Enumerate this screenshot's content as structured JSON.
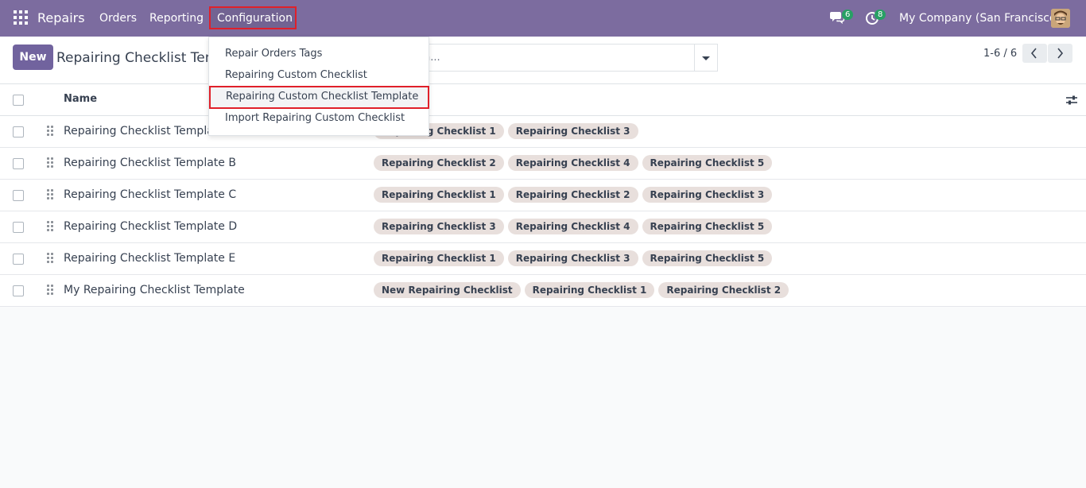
{
  "navbar": {
    "brand": "Repairs",
    "menu": [
      "Orders",
      "Reporting",
      "Configuration"
    ],
    "messages_count": "6",
    "activities_count": "8",
    "company": "My Company (San Francisco)"
  },
  "control_panel": {
    "new_label": "New",
    "breadcrumb": "Repairing Checklist Templ",
    "search_placeholder": "h...",
    "pager": "1-6 / 6"
  },
  "table": {
    "header_name": "Name",
    "rows": [
      {
        "name": "Repairing Checklist Template",
        "tags": [
          "Repairing Checklist 1",
          "Repairing Checklist 3"
        ]
      },
      {
        "name": "Repairing Checklist Template B",
        "tags": [
          "Repairing Checklist 2",
          "Repairing Checklist 4",
          "Repairing Checklist 5"
        ]
      },
      {
        "name": "Repairing Checklist Template C",
        "tags": [
          "Repairing Checklist 1",
          "Repairing Checklist 2",
          "Repairing Checklist 3"
        ]
      },
      {
        "name": "Repairing Checklist Template D",
        "tags": [
          "Repairing Checklist 3",
          "Repairing Checklist 4",
          "Repairing Checklist 5"
        ]
      },
      {
        "name": "Repairing Checklist Template E",
        "tags": [
          "Repairing Checklist 1",
          "Repairing Checklist 3",
          "Repairing Checklist 5"
        ]
      },
      {
        "name": "My Repairing Checklist Template",
        "tags": [
          "New Repairing Checklist",
          "Repairing Checklist 1",
          "Repairing Checklist 2"
        ]
      }
    ]
  },
  "config_menu": {
    "items": [
      "Repair Orders Tags",
      "Repairing Custom Checklist",
      "Repairing Custom Checklist Template",
      "Import Repairing Custom Checklist"
    ]
  },
  "colors": {
    "navbar": "#7c6c9f",
    "primary": "#71639e",
    "badge": "#27a064",
    "highlight": "#e0202a",
    "tag": "#e8dfdc"
  },
  "icons": [
    "apps-grid-icon",
    "chat-icon",
    "clock-icon",
    "avatar",
    "caret-down-icon",
    "chevron-left-icon",
    "chevron-right-icon",
    "drag-handle-icon",
    "column-settings-icon"
  ]
}
